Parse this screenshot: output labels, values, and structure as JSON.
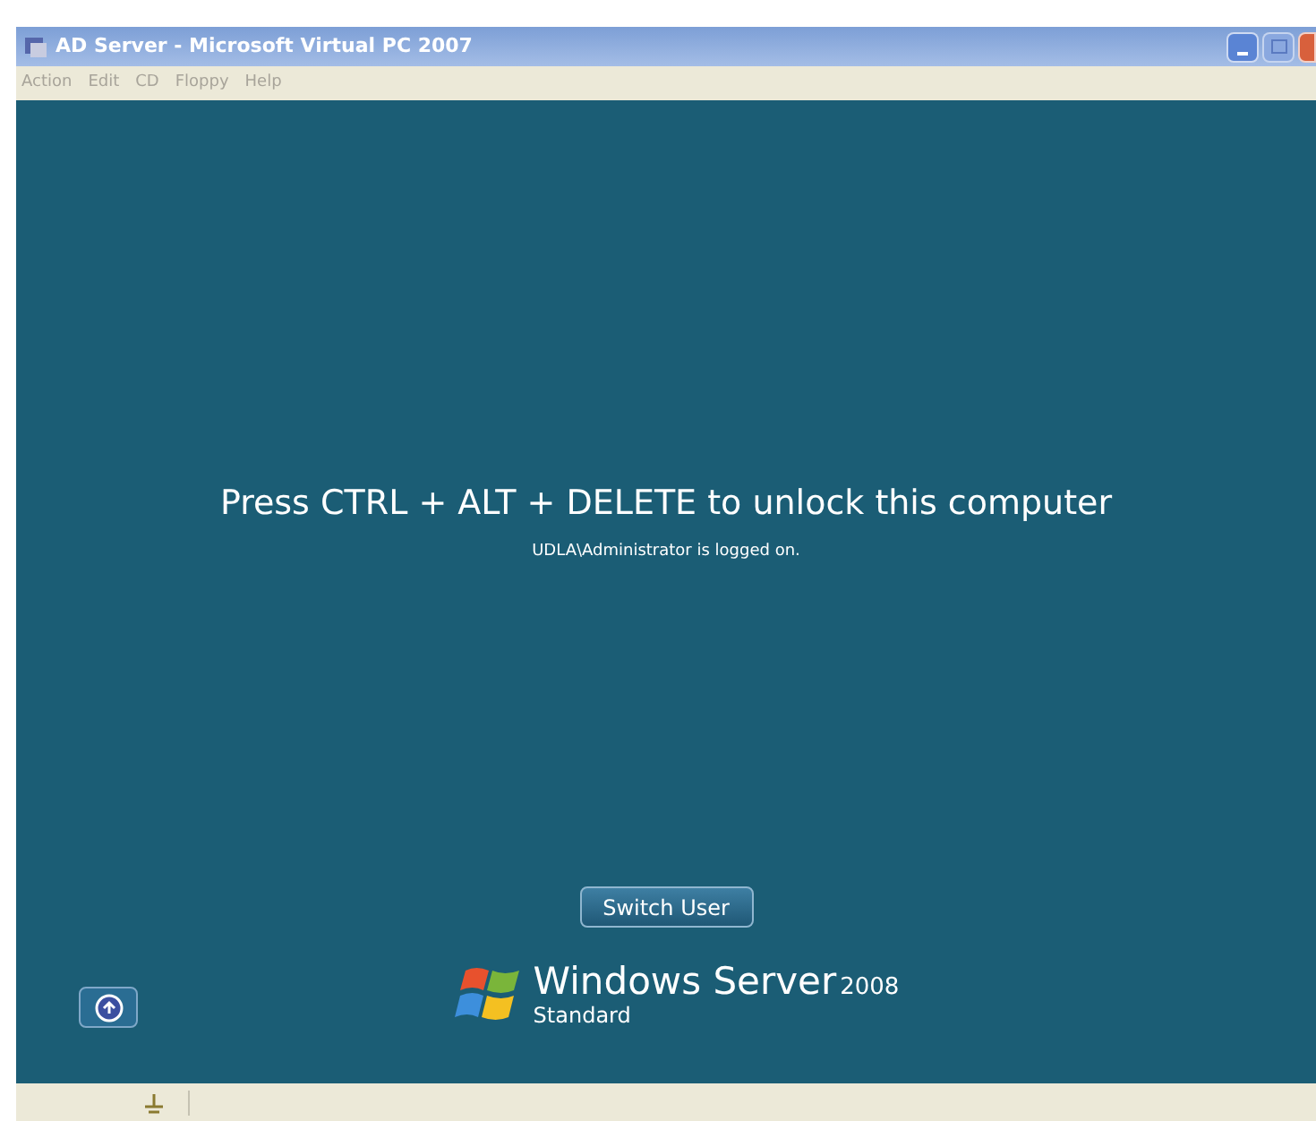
{
  "window": {
    "title": "AD Server - Microsoft Virtual PC 2007"
  },
  "menu": [
    {
      "label": "Action",
      "disabled": true
    },
    {
      "label": "Edit",
      "disabled": true
    },
    {
      "label": "CD",
      "disabled": true
    },
    {
      "label": "Floppy",
      "disabled": true
    },
    {
      "label": "Help",
      "disabled": true
    }
  ],
  "lock_screen": {
    "message": "Press CTRL + ALT + DELETE to unlock this computer",
    "status": "UDLA\\Administrator is logged on.",
    "switch_user_button": "Switch User",
    "brand": {
      "name": "Windows Server",
      "version": "2008",
      "edition": "Standard"
    }
  }
}
